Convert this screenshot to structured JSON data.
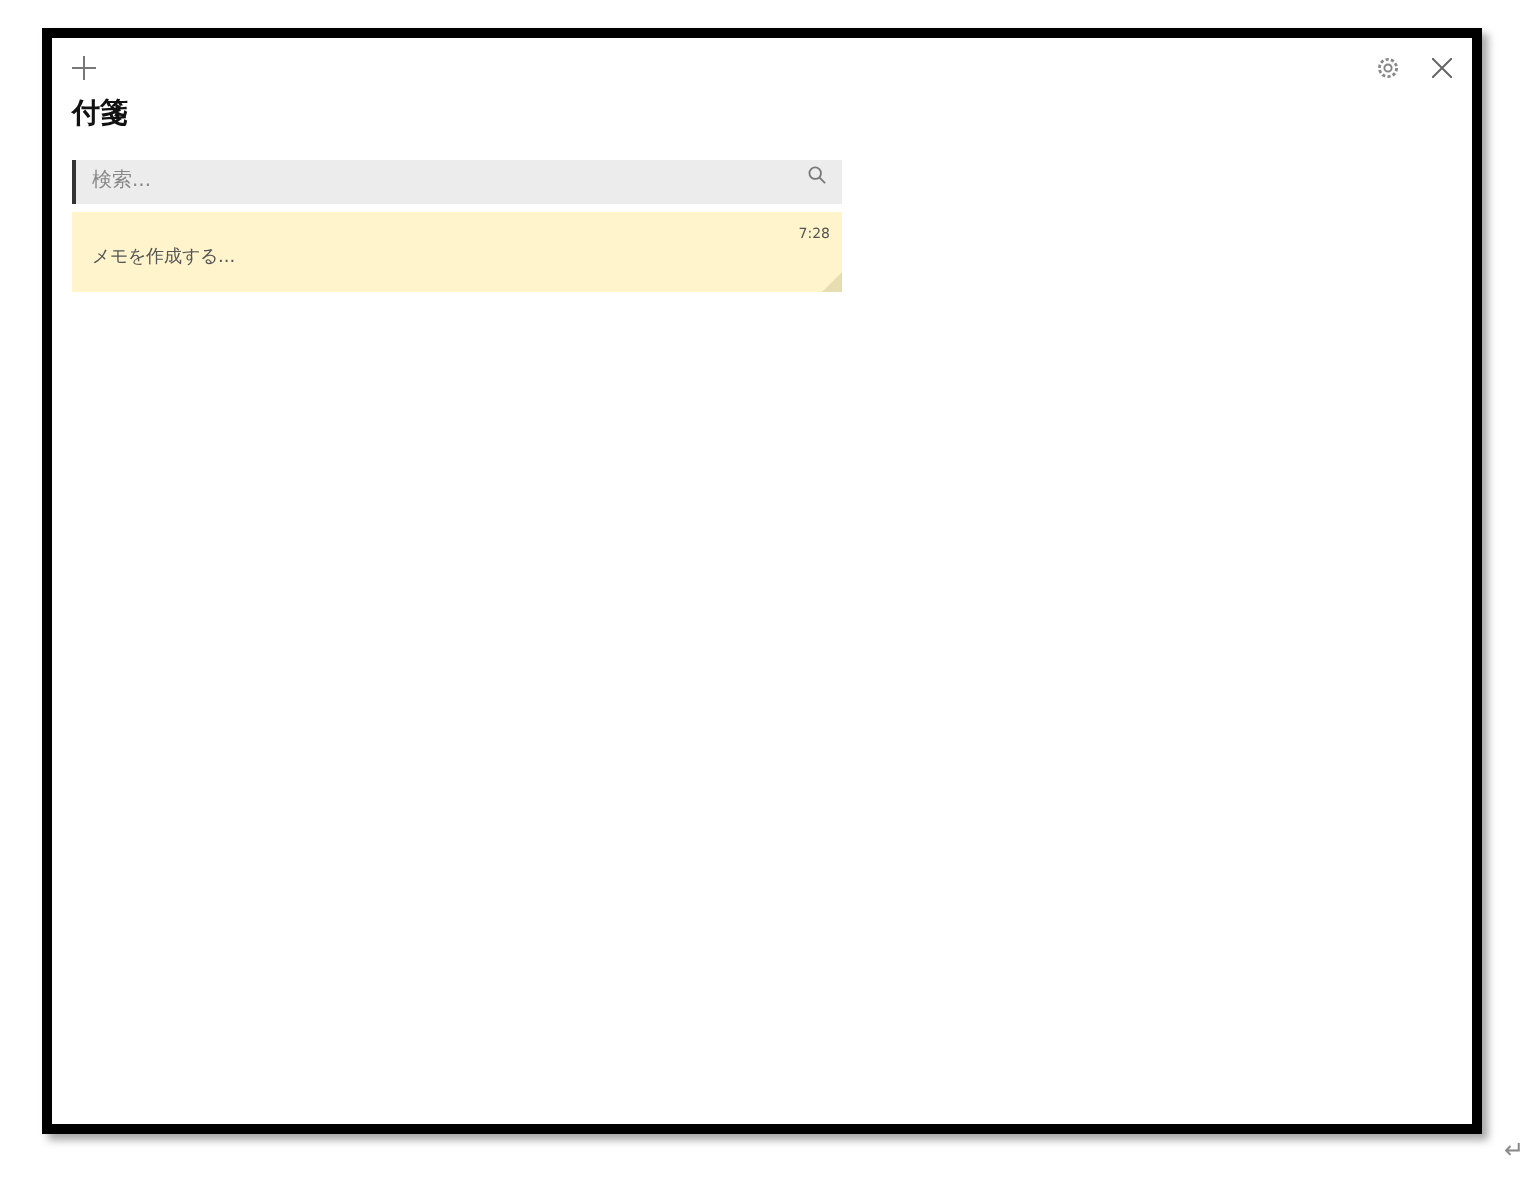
{
  "window": {
    "title": "付箋"
  },
  "search": {
    "placeholder": "検索..."
  },
  "notes": [
    {
      "text": "メモを作成する...",
      "time": "7:28",
      "color": "#fff4cc"
    }
  ],
  "paragraph_mark": "↵"
}
